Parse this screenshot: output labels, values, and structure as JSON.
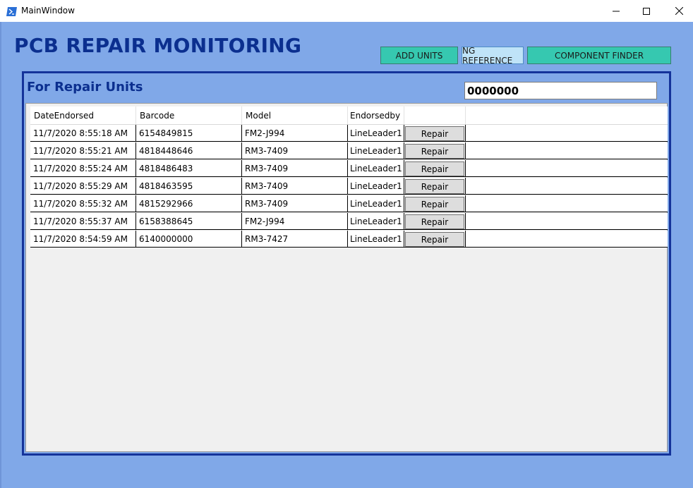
{
  "window": {
    "title": "MainWindow"
  },
  "app_title": "PCB REPAIR MONITORING",
  "toolbar": {
    "add_units": "ADD UNITS",
    "ng_reference": "NG REFERENCE",
    "component_finder": "COMPONENT FINDER"
  },
  "panel": {
    "title": "For Repair Units",
    "scan_value": "0000000"
  },
  "table": {
    "headers": [
      "DateEndorsed",
      "Barcode",
      "Model",
      "Endorsedby",
      ""
    ],
    "rows": [
      {
        "date": "11/7/2020 8:55:18 AM",
        "barcode": "6154849815",
        "model": "FM2-J994",
        "endorsedby": "LineLeader1",
        "action": "Repair"
      },
      {
        "date": "11/7/2020 8:55:21 AM",
        "barcode": "4818448646",
        "model": "RM3-7409",
        "endorsedby": "LineLeader1",
        "action": "Repair"
      },
      {
        "date": "11/7/2020 8:55:24 AM",
        "barcode": "4818486483",
        "model": "RM3-7409",
        "endorsedby": "LineLeader1",
        "action": "Repair"
      },
      {
        "date": "11/7/2020 8:55:29 AM",
        "barcode": "4818463595",
        "model": "RM3-7409",
        "endorsedby": "LineLeader1",
        "action": "Repair"
      },
      {
        "date": "11/7/2020 8:55:32 AM",
        "barcode": "4815292966",
        "model": "RM3-7409",
        "endorsedby": "LineLeader1",
        "action": "Repair"
      },
      {
        "date": "11/7/2020 8:55:37 AM",
        "barcode": "6158388645",
        "model": "FM2-J994",
        "endorsedby": "LineLeader1",
        "action": "Repair"
      },
      {
        "date": "11/7/2020 8:54:59 AM",
        "barcode": "6140000000",
        "model": "RM3-7427",
        "endorsedby": "LineLeader1",
        "action": "Repair"
      }
    ]
  },
  "colors": {
    "background": "#80a8e8",
    "title_text": "#0b2f8f",
    "panel_border": "#14339a",
    "teal_button": "#36c8b0",
    "ng_button": "#bfe3f8"
  },
  "icons": {
    "app": "powershell-icon",
    "minimize": "minimize-icon",
    "maximize": "maximize-icon",
    "close": "close-icon"
  }
}
